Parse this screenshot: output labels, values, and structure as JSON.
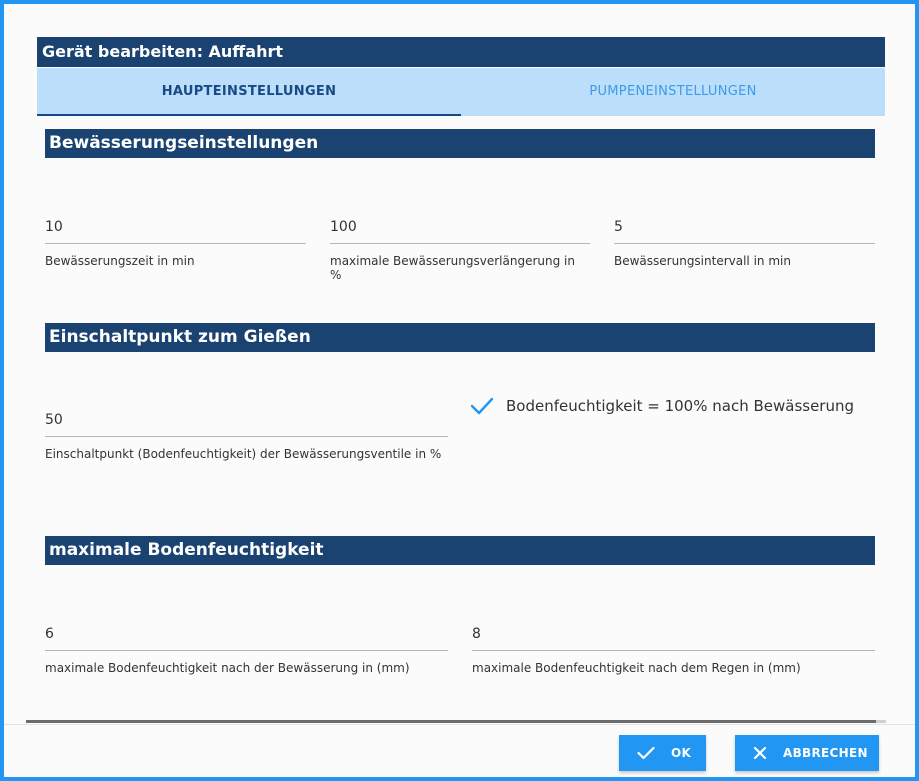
{
  "dialog": {
    "title": "Gerät bearbeiten: Auffahrt"
  },
  "tabs": [
    {
      "label": "HAUPTEINSTELLUNGEN",
      "active": true
    },
    {
      "label": "PUMPENEINSTELLUNGEN",
      "active": false
    }
  ],
  "sections": {
    "irrigation": {
      "title": "Bewässerungseinstellungen",
      "fields": [
        {
          "value": "10",
          "label": "Bewässerungszeit in min"
        },
        {
          "value": "100",
          "label": "maximale Bewässerungsverlängerung in %"
        },
        {
          "value": "5",
          "label": "Bewässerungsintervall in min"
        }
      ]
    },
    "switch_point": {
      "title": "Einschaltpunkt zum Gießen",
      "field": {
        "value": "50",
        "label": "Einschaltpunkt (Bodenfeuchtigkeit) der Bewässerungsventile in %"
      },
      "checkbox": {
        "label": "Bodenfeuchtigkeit = 100% nach Bewässerung",
        "checked": true,
        "icon": "check-icon"
      }
    },
    "max_moisture": {
      "title": "maximale Bodenfeuchtigkeit",
      "fields": [
        {
          "value": "6",
          "label": "maximale Bodenfeuchtigkeit nach der Bewässerung in (mm)"
        },
        {
          "value": "8",
          "label": "maximale Bodenfeuchtigkeit nach dem Regen in (mm)"
        }
      ]
    }
  },
  "buttons": {
    "ok": {
      "label": "OK",
      "icon": "check-icon"
    },
    "cancel": {
      "label": "ABBRECHEN",
      "icon": "close-icon"
    }
  },
  "colors": {
    "header": "#1a4371",
    "tab_bar": "#bbdefb",
    "accent": "#2196f3"
  }
}
